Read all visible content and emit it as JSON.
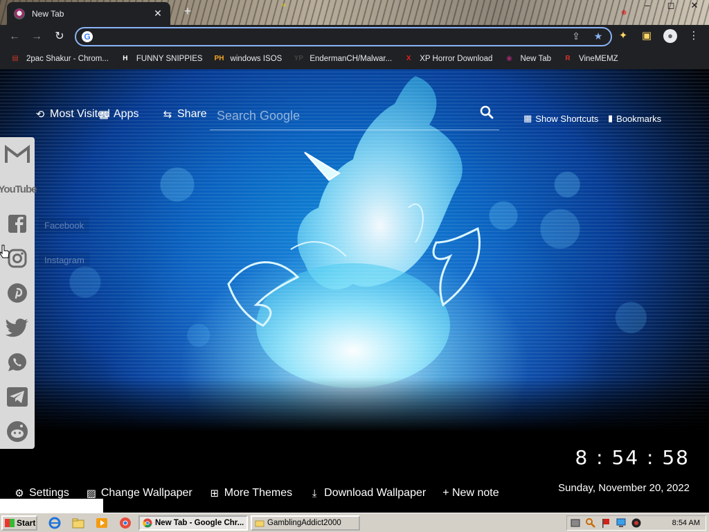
{
  "browser": {
    "tab": {
      "title": "New Tab",
      "close_glyph": "✕"
    },
    "new_tab_glyph": "+",
    "window_controls": [
      "–",
      "◻",
      "✕"
    ],
    "omnibox": {
      "value": "",
      "placeholder": ""
    },
    "bookmarks": [
      {
        "label": "2pac Shakur - Chrom...",
        "icon": "bookmark-2pac-icon",
        "glyph": "▤",
        "color": "#c0392b"
      },
      {
        "label": "FUNNY SNIPPIES",
        "icon": "bookmark-h-icon",
        "glyph": "H",
        "color": "#ffffff"
      },
      {
        "label": "windows ISOS",
        "icon": "bookmark-ph-icon",
        "glyph": "PH",
        "color": "#f5a623"
      },
      {
        "label": "EndermanCH/Malwar...",
        "icon": "bookmark-yp-icon",
        "glyph": "YP",
        "color": "#444444"
      },
      {
        "label": "XP Horror Download",
        "icon": "bookmark-x-icon",
        "glyph": "X",
        "color": "#e02020"
      },
      {
        "label": "New Tab",
        "icon": "bookmark-newtab-icon",
        "glyph": "◉",
        "color": "#9a2a6a"
      },
      {
        "label": "VineMEMZ",
        "icon": "bookmark-r-icon",
        "glyph": "R",
        "color": "#d0342c"
      }
    ]
  },
  "newtab": {
    "nav": {
      "most_visited": "Most Visited",
      "apps": "Apps",
      "share": "Share",
      "show_shortcuts": "Show Shortcuts",
      "bookmarks": "Bookmarks"
    },
    "search": {
      "placeholder": "Search Google"
    },
    "social": {
      "items": [
        "gmail",
        "youtube",
        "facebook",
        "instagram",
        "pinterest",
        "twitter",
        "whatsapp",
        "telegram",
        "reddit"
      ],
      "youtube_label": "YouTube",
      "tooltips": {
        "facebook": "Facebook",
        "instagram": "Instagram"
      }
    },
    "clock": {
      "time": "8 : 54 : 58",
      "date": "Sunday, November 20, 2022"
    },
    "bottom": {
      "settings": "Settings",
      "change_wallpaper": "Change Wallpaper",
      "more_themes": "More Themes",
      "download_wallpaper": "Download Wallpaper",
      "new_note": "+ New note"
    },
    "colors": {
      "accent": "#8ab4f8",
      "glow": "#0f8bd9"
    }
  },
  "taskbar": {
    "start_label": "Start",
    "tasks": [
      {
        "label": "New Tab - Google Chr...",
        "active": true
      },
      {
        "label": "GamblingAddict2000",
        "active": false
      }
    ],
    "time": "8:54 AM"
  }
}
